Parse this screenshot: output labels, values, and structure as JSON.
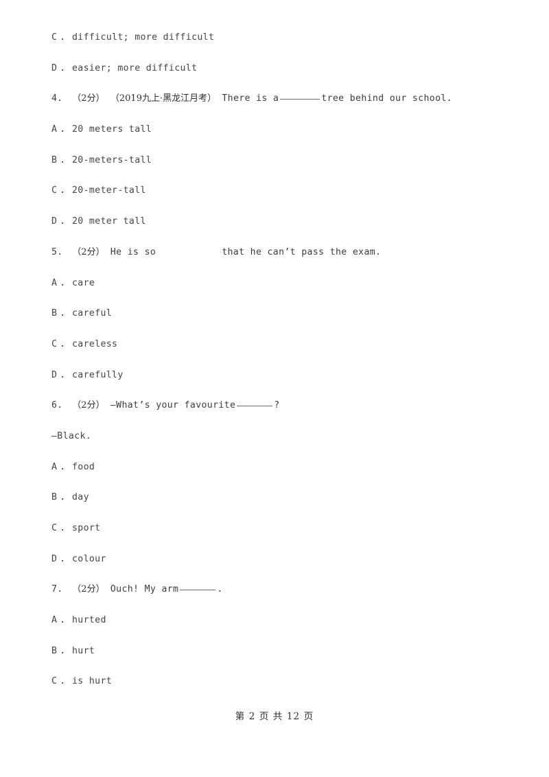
{
  "document": {
    "page_background": "#ffffff",
    "text_color": "#444444"
  },
  "body_lines": [
    {
      "kind": "option",
      "letter": "C",
      "dot": "．",
      "text": "difficult; more difficult"
    },
    {
      "kind": "option",
      "letter": "D",
      "dot": "．",
      "text": "easier; more difficult"
    },
    {
      "kind": "question",
      "number": "4.",
      "points": "（2分）",
      "source": "（2019九上·黑龙江月考）",
      "text_before": "There is a",
      "blank": "underline",
      "text_after": "tree behind our school."
    },
    {
      "kind": "option",
      "letter": "A",
      "dot": "．",
      "text": "20 meters tall"
    },
    {
      "kind": "option",
      "letter": "B",
      "dot": "．",
      "text": "20-meters-tall"
    },
    {
      "kind": "option",
      "letter": "C",
      "dot": "．",
      "text": "20-meter-tall"
    },
    {
      "kind": "option",
      "letter": "D",
      "dot": "．",
      "text": "20 meter tall"
    },
    {
      "kind": "question",
      "number": "5.",
      "points": "（2分）",
      "source": "",
      "text_before": "He is so",
      "blank": "space",
      "text_after": "that he can’t pass the exam."
    },
    {
      "kind": "option",
      "letter": "A",
      "dot": "．",
      "text": "care"
    },
    {
      "kind": "option",
      "letter": "B",
      "dot": "．",
      "text": "careful"
    },
    {
      "kind": "option",
      "letter": "C",
      "dot": "．",
      "text": "careless"
    },
    {
      "kind": "option",
      "letter": "D",
      "dot": "．",
      "text": "carefully"
    },
    {
      "kind": "question",
      "number": "6.",
      "points": "（2分）",
      "source": "",
      "text_before": "—What’s your favourite",
      "blank": "underline-short",
      "text_after": "?"
    },
    {
      "kind": "answer",
      "text": "—Black."
    },
    {
      "kind": "option",
      "letter": "A",
      "dot": "．",
      "text": "food"
    },
    {
      "kind": "option",
      "letter": "B",
      "dot": "．",
      "text": "day"
    },
    {
      "kind": "option",
      "letter": "C",
      "dot": "．",
      "text": "sport"
    },
    {
      "kind": "option",
      "letter": "D",
      "dot": "．",
      "text": "colour"
    },
    {
      "kind": "question",
      "number": "7.",
      "points": "（2分）",
      "source": "",
      "text_before": "Ouch! My arm",
      "blank": "underline-short",
      "text_after": "."
    },
    {
      "kind": "option",
      "letter": "A",
      "dot": "．",
      "text": "hurted"
    },
    {
      "kind": "option",
      "letter": "B",
      "dot": "．",
      "text": "hurt"
    },
    {
      "kind": "option",
      "letter": "C",
      "dot": "．",
      "text": "is hurt"
    }
  ],
  "footer": {
    "text": "第 2 页 共 12 页"
  }
}
